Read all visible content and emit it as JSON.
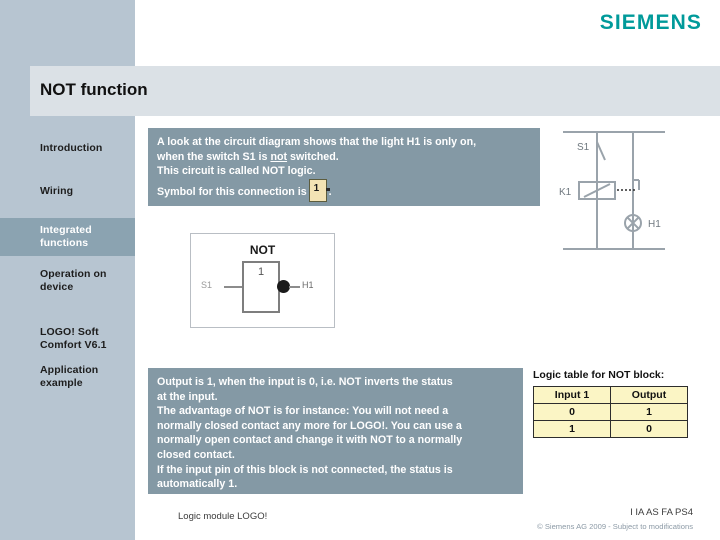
{
  "brand": {
    "logo_text": "SIEMENS",
    "logo_color": "#009a9a"
  },
  "header": {
    "title": "NOT function"
  },
  "sidebar": {
    "items": [
      {
        "label": "Introduction",
        "active": false
      },
      {
        "label": "Wiring",
        "active": false
      },
      {
        "label": "Integrated functions",
        "active": true
      },
      {
        "label": "Operation on device",
        "active": false
      },
      {
        "label": "LOGO! Soft Comfort V6.1",
        "active": false
      },
      {
        "label": "Application example",
        "active": false
      }
    ],
    "active_bg": "#8ba3b1",
    "bg": "#b7c5d1"
  },
  "intro_text": {
    "line1": "A look at the circuit diagram shows that the light H1 is only on,",
    "line2_a": "when the switch S1 is ",
    "line2_underlined": "not",
    "line2_b": " switched.",
    "line3": "This circuit is called NOT logic.",
    "line4_a": "Symbol for this connection is",
    "symbol_label": "1",
    "line4_b": "."
  },
  "not_diagram": {
    "title": "NOT",
    "gate_label": "1",
    "input_label": "S1",
    "output_label": "H1"
  },
  "circuit_diagram": {
    "switch_label": "S1",
    "relay_label": "K1",
    "lamp_label": "H1"
  },
  "detail_text": {
    "line1": "Output is 1, when the input is 0, i.e. NOT inverts the status",
    "line2": "at the input.",
    "line3": "The advantage of NOT is for instance: You will not need a",
    "line4": "normally closed contact any more for LOGO!. You can use a",
    "line5": "normally open contact and change it with NOT to a normally",
    "line6": "closed contact.",
    "line7": "If the input pin of this block is not connected, the status is",
    "line8": "automatically 1."
  },
  "logic_table": {
    "title": "Logic table for NOT block:",
    "headers": [
      "Input  1",
      "Output"
    ],
    "rows": [
      [
        "0",
        "1"
      ],
      [
        "1",
        "0"
      ]
    ]
  },
  "footer": {
    "left": "Logic module LOGO!",
    "right": "I IA AS FA PS4",
    "copyright": "© Siemens AG 2009 - Subject to modifications"
  }
}
